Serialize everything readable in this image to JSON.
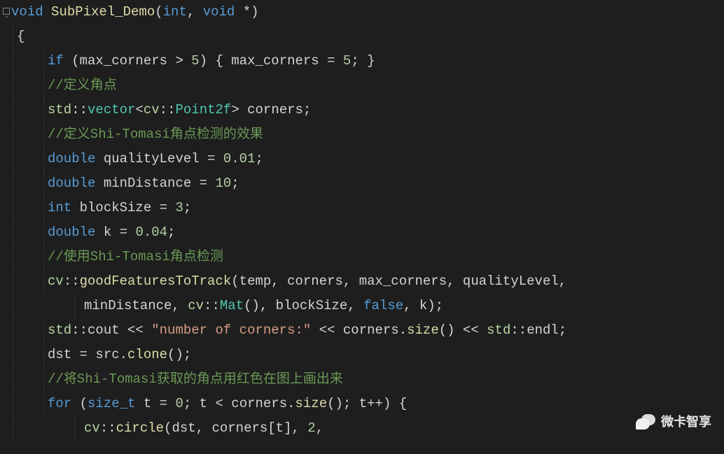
{
  "code": {
    "line1": {
      "kw_void": "void",
      "fn_name": " SubPixel_Demo",
      "paren_open": "(",
      "kw_int": "int",
      "comma": ", ",
      "kw_void2": "void",
      "star": " *",
      "paren_close": ")"
    },
    "line2": {
      "brace": "{"
    },
    "line3": {
      "kw_if": "if",
      "open": " (max_corners ",
      "op": "> ",
      "num5": "5",
      "close_if": ") { max_corners = ",
      "num5b": "5",
      "end": "; }"
    },
    "line4": {
      "cmt": "//定义角点"
    },
    "line5": {
      "std": "std",
      "sep1": "::",
      "vector": "vector",
      "lt": "<",
      "cv": "cv",
      "sep2": "::",
      "point2f": "Point2f",
      "gt": ">",
      "rest": " corners;"
    },
    "line6": {
      "cmt": "//定义Shi-Tomasi角点检测的效果"
    },
    "line7": {
      "kw": "double",
      "id": " qualityLevel = ",
      "num": "0.01",
      "semi": ";"
    },
    "line8": {
      "kw": "double",
      "id": " minDistance = ",
      "num": "10",
      "semi": ";"
    },
    "line9": {
      "kw": "int",
      "id": " blockSize = ",
      "num": "3",
      "semi": ";"
    },
    "line10": {
      "kw": "double",
      "id": " k = ",
      "num": "0.04",
      "semi": ";"
    },
    "line11": {
      "cmt": "//使用Shi-Tomasi角点检测"
    },
    "line12": {
      "cv": "cv",
      "sep": "::",
      "fn": "goodFeaturesToTrack",
      "args": "(temp, corners, max_corners, qualityLevel,"
    },
    "line13": {
      "args1": "minDistance, ",
      "cv": "cv",
      "sep": "::",
      "mat": "Mat",
      "args2": "(), blockSize, ",
      "kw_false": "false",
      "args3": ", k);"
    },
    "line14": {
      "std1": "std",
      "sep1": "::",
      "cout": "cout",
      "op1": " << ",
      "str": "\"number of corners:\"",
      "op2": " << ",
      "call": "corners.",
      "size": "size",
      "call2": "() << ",
      "std2": "std",
      "sep2": "::",
      "endl": "endl",
      "semi": ";"
    },
    "line15": {
      "id1": "dst = src.",
      "clone": "clone",
      "rest": "();"
    },
    "line16": {
      "cmt": "//将Shi-Tomasi获取的角点用红色在图上画出来"
    },
    "line17": {
      "kw_for": "for",
      "open": " (",
      "size_t": "size_t",
      "id": " t = ",
      "num0": "0",
      "mid": "; t < corners.",
      "size": "size",
      "mid2": "(); t",
      "op_inc": "++",
      "close": ") {"
    },
    "line18": {
      "cv": "cv",
      "sep": "::",
      "circle": "circle",
      "args": "(dst, corners[t], ",
      "num2": "2",
      "comma": ","
    }
  },
  "watermark": {
    "text": "微卡智享"
  }
}
